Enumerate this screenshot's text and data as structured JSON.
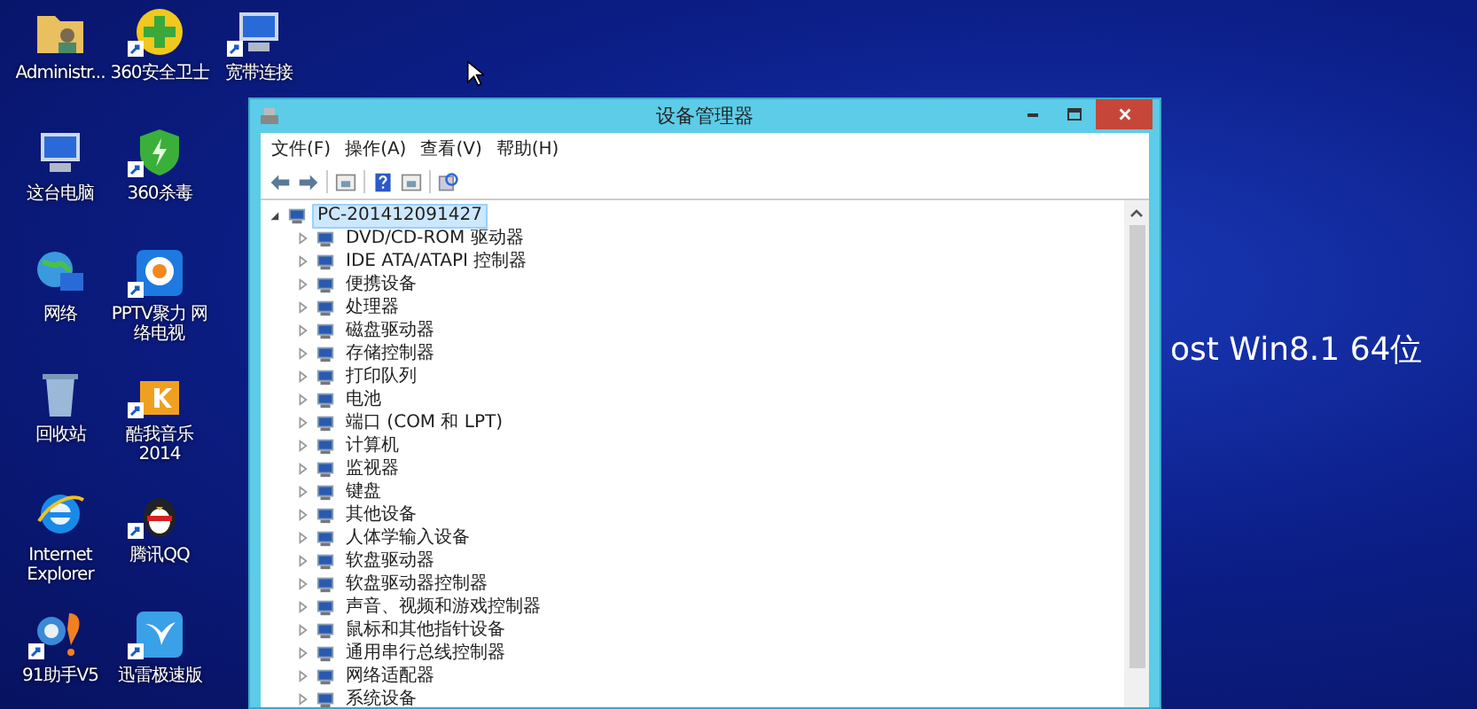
{
  "desktop": {
    "rows": [
      [
        {
          "label": "Administr...",
          "kind": "folder",
          "shortcut": false
        },
        {
          "label": "360安全卫士",
          "kind": "plus",
          "shortcut": true
        },
        {
          "label": "宽带连接",
          "kind": "network",
          "shortcut": true
        }
      ],
      [
        {
          "label": "这台电脑",
          "kind": "computer",
          "shortcut": false
        },
        {
          "label": "360杀毒",
          "kind": "shield",
          "shortcut": true
        }
      ],
      [
        {
          "label": "网络",
          "kind": "globe",
          "shortcut": false
        },
        {
          "label": [
            "PPTV聚力 网",
            "络电视"
          ],
          "kind": "play",
          "shortcut": true
        }
      ],
      [
        {
          "label": "回收站",
          "kind": "bin",
          "shortcut": false
        },
        {
          "label": [
            "酷我音乐",
            "2014"
          ],
          "kind": "music",
          "shortcut": true
        }
      ],
      [
        {
          "label": [
            "Internet",
            "Explorer"
          ],
          "kind": "browser",
          "shortcut": false
        },
        {
          "label": "腾讯QQ",
          "kind": "penguin",
          "shortcut": true
        }
      ],
      [
        {
          "label": "91助手V5",
          "kind": "balloon",
          "shortcut": true
        },
        {
          "label": "迅雷极速版",
          "kind": "bird",
          "shortcut": true
        }
      ]
    ]
  },
  "wallpaper_text": "ost Win8.1 64位",
  "window": {
    "title": "设备管理器",
    "menu": [
      "文件(F)",
      "操作(A)",
      "查看(V)",
      "帮助(H)"
    ],
    "toolbar": [
      {
        "kind": "back"
      },
      {
        "kind": "forward"
      },
      {
        "kind": "sep"
      },
      {
        "kind": "props"
      },
      {
        "kind": "sep"
      },
      {
        "kind": "help"
      },
      {
        "kind": "props"
      },
      {
        "kind": "sep"
      },
      {
        "kind": "scan"
      }
    ],
    "tree": [
      {
        "label": "PC-201412091427",
        "expanded": true,
        "selected": true,
        "children": [
          {
            "label": "DVD/CD-ROM 驱动器",
            "expanded": false,
            "selected": false
          },
          {
            "label": "IDE ATA/ATAPI 控制器",
            "expanded": false,
            "selected": false
          },
          {
            "label": "便携设备",
            "expanded": false,
            "selected": false
          },
          {
            "label": "处理器",
            "expanded": false,
            "selected": false
          },
          {
            "label": "磁盘驱动器",
            "expanded": false,
            "selected": false
          },
          {
            "label": "存储控制器",
            "expanded": false,
            "selected": false
          },
          {
            "label": "打印队列",
            "expanded": false,
            "selected": false
          },
          {
            "label": "电池",
            "expanded": false,
            "selected": false
          },
          {
            "label": "端口 (COM 和 LPT)",
            "expanded": false,
            "selected": false
          },
          {
            "label": "计算机",
            "expanded": false,
            "selected": false
          },
          {
            "label": "监视器",
            "expanded": false,
            "selected": false
          },
          {
            "label": "键盘",
            "expanded": false,
            "selected": false
          },
          {
            "label": "其他设备",
            "expanded": false,
            "selected": false
          },
          {
            "label": "人体学输入设备",
            "expanded": false,
            "selected": false
          },
          {
            "label": "软盘驱动器",
            "expanded": false,
            "selected": false
          },
          {
            "label": "软盘驱动器控制器",
            "expanded": false,
            "selected": false
          },
          {
            "label": "声音、视频和游戏控制器",
            "expanded": false,
            "selected": false
          },
          {
            "label": "鼠标和其他指针设备",
            "expanded": false,
            "selected": false
          },
          {
            "label": "通用串行总线控制器",
            "expanded": false,
            "selected": false
          },
          {
            "label": "网络适配器",
            "expanded": false,
            "selected": false
          },
          {
            "label": "系统设备",
            "expanded": false,
            "selected": false
          }
        ]
      }
    ]
  }
}
